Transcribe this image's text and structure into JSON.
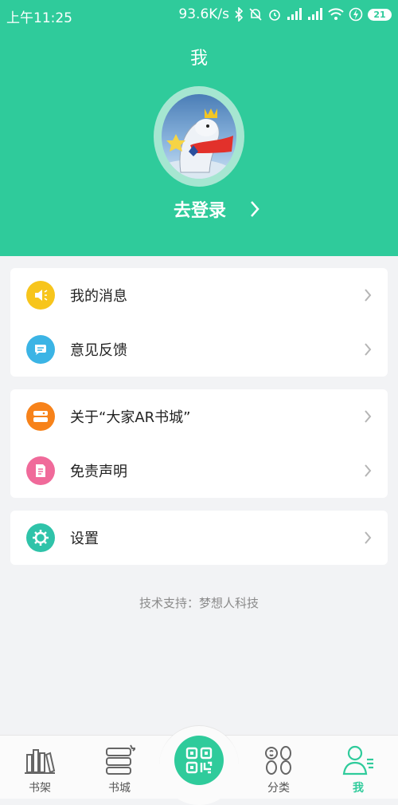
{
  "status_bar": {
    "time": "上午11:25",
    "net_speed": "93.6K/s",
    "battery": "21"
  },
  "header": {
    "title": "我",
    "login_label": "去登录"
  },
  "menu": {
    "messages": "我的消息",
    "feedback": "意见反馈",
    "about": "关于“大家AR书城”",
    "disclaimer": "免责声明",
    "settings": "设置"
  },
  "footer_note": "技术支持：梦想人科技",
  "tabs": {
    "bookshelf": "书架",
    "bookstore": "书城",
    "category": "分类",
    "me": "我"
  },
  "colors": {
    "brand": "#2fcb9b",
    "messages_icon": "#f7c51c",
    "feedback_icon": "#3bb4e5",
    "about_icon": "#f7821a",
    "disclaimer_icon": "#f06a9a",
    "settings_icon": "#2fc3a9"
  },
  "icons": {
    "messages": "speaker-icon",
    "feedback": "chat-bubble-icon",
    "about": "info-card-icon",
    "disclaimer": "document-icon",
    "settings": "gear-icon",
    "scan": "qr-scan-icon"
  }
}
